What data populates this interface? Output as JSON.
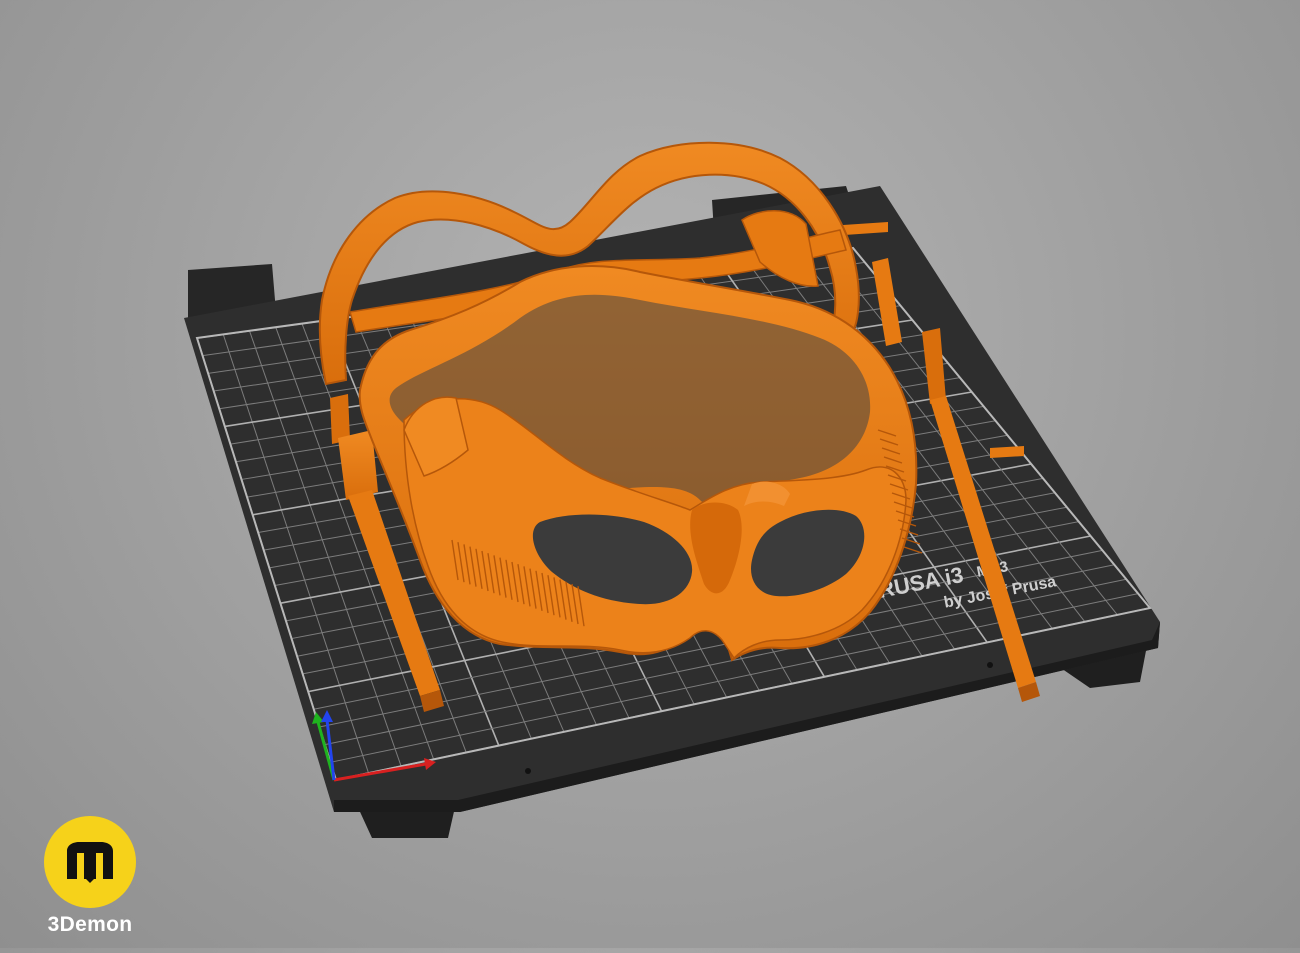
{
  "viewport": {
    "background": "#a6a6a6",
    "bed_color": "#2e2e2e",
    "grid_color": "#8a8a8a",
    "model_color": "#e67a12",
    "model_shadow": "#b5570a"
  },
  "bed": {
    "brand_line": "RUSA i3 MK3",
    "brand_main": "RUSA i3",
    "brand_model": "MK3",
    "brand_author": "by Josef Prusa"
  },
  "axes": {
    "x_color": "#d82020",
    "y_color": "#1fb31f",
    "z_color": "#2244ee"
  },
  "watermark": {
    "icon": "3demon-logo-icon",
    "name": "3Demon",
    "badge_color": "#f6d21a"
  }
}
